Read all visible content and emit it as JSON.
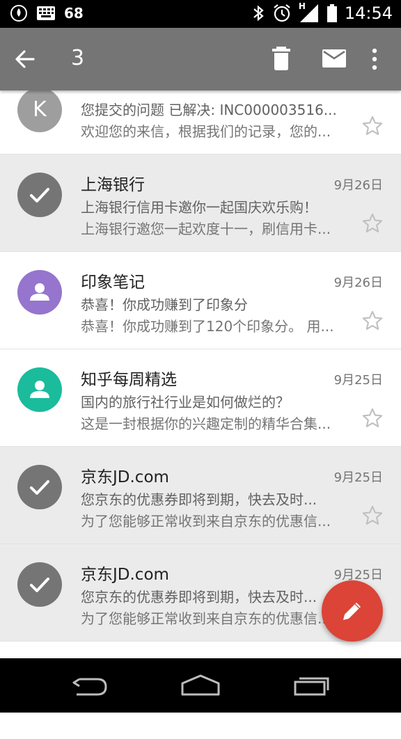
{
  "status_bar": {
    "notification_count": "68",
    "time": "14:54",
    "network_type": "H",
    "icons": [
      "data-saver-icon",
      "keyboard-icon",
      "bluetooth-icon",
      "alarm-icon",
      "signal-icon",
      "battery-icon"
    ]
  },
  "action_bar": {
    "selected_count": "3",
    "icons": [
      "back-arrow-icon",
      "delete-icon",
      "mark-unread-icon",
      "more-vert-icon"
    ],
    "color": "#757575"
  },
  "emails": [
    {
      "sender": "",
      "avatar_letter": "K",
      "subject": "您提交的问题 已解决: INC000003516...",
      "snippet": "欢迎您的来信，根据我们的记录，您的...",
      "date": "",
      "selected": false
    },
    {
      "sender": "上海银行",
      "subject": "上海银行信用卡邀你一起国庆欢乐购！",
      "snippet": "上海银行邀您一起欢度十一，刷信用卡...",
      "date": "9月26日",
      "selected": true
    },
    {
      "sender": "印象笔记",
      "subject": "恭喜！你成功赚到了印象分",
      "snippet": "恭喜！你成功赚到了120个印象分。 用...",
      "date": "9月26日",
      "selected": false,
      "avatar_color": "#9575cd"
    },
    {
      "sender": "知乎每周精选",
      "subject": "国内的旅行社行业是如何做烂的？",
      "snippet": "这是一封根据你的兴趣定制的精华合集...",
      "date": "9月25日",
      "selected": false,
      "avatar_color": "#1abc9c"
    },
    {
      "sender": "京东JD.com",
      "subject": "您京东的优惠券即将到期，快去及时...",
      "snippet": "为了您能够正常收到来自京东的优惠信...",
      "date": "9月25日",
      "selected": true
    },
    {
      "sender": "京东JD.com",
      "subject": "您京东的优惠券即将到期，快去及时...",
      "snippet": "为了您能够正常收到来自京东的优惠信...",
      "date": "9月25日",
      "selected": true
    }
  ],
  "fab": {
    "icon": "pencil-icon",
    "color": "#db4437"
  },
  "nav_bar": {
    "icons": [
      "back-icon",
      "home-icon",
      "recents-icon"
    ]
  }
}
